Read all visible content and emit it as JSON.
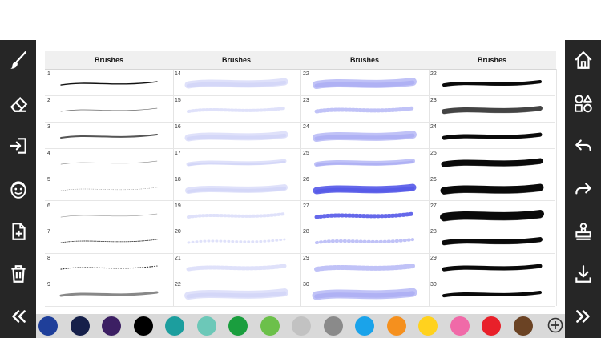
{
  "left_toolbar": [
    {
      "icon": "brush-icon"
    },
    {
      "icon": "eraser-icon"
    },
    {
      "icon": "import-icon"
    },
    {
      "icon": "emoji-icon"
    },
    {
      "icon": "new-file-icon"
    },
    {
      "icon": "trash-icon"
    },
    {
      "icon": "collapse-left-icon"
    }
  ],
  "right_toolbar": [
    {
      "icon": "home-icon"
    },
    {
      "icon": "shapes-icon"
    },
    {
      "icon": "undo-icon"
    },
    {
      "icon": "redo-icon"
    },
    {
      "icon": "stamp-icon"
    },
    {
      "icon": "download-icon"
    },
    {
      "icon": "expand-right-icon"
    }
  ],
  "brush_panels": [
    {
      "title": "Brushes",
      "numbers": [
        "1",
        "2",
        "3",
        "4",
        "5",
        "6",
        "7",
        "8",
        "9"
      ],
      "style": "pen"
    },
    {
      "title": "Brushes",
      "numbers": [
        "14",
        "15",
        "16",
        "17",
        "18",
        "19",
        "20",
        "21",
        "22"
      ],
      "style": "watercolor"
    },
    {
      "title": "Brushes",
      "numbers": [
        "22",
        "23",
        "24",
        "25",
        "26",
        "27",
        "28",
        "29",
        "30"
      ],
      "style": "watercolor-blue"
    },
    {
      "title": "Brushes",
      "numbers": [
        "22",
        "23",
        "24",
        "25",
        "26",
        "27",
        "28",
        "29",
        "30"
      ],
      "style": "ink"
    }
  ],
  "palette": {
    "colors": [
      "#1f3f9a",
      "#16204a",
      "#3c1f63",
      "#000000",
      "#1c9e9e",
      "#6cc8b8",
      "#1a9e3e",
      "#6cc04a",
      "#c2c2c2",
      "#8a8a8a",
      "#1aa3ea",
      "#f5901e",
      "#ffd21e",
      "#f06aa8",
      "#e8202a",
      "#6b4324"
    ],
    "add_icon": "add-color-icon"
  }
}
